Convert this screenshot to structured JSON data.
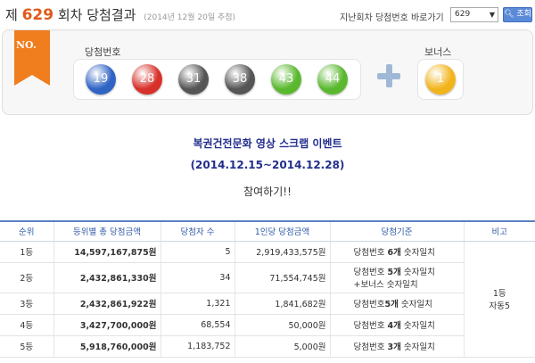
{
  "header": {
    "prefix": "제",
    "round": "629",
    "suffix": "회차 당첨결과",
    "date": "(2014년 12월 20일 추첨)",
    "prev_label": "지난회차 당첨번호 바로가기",
    "select_value": "629",
    "search_label": "조회",
    "search_icon": "magnifier-icon"
  },
  "panel": {
    "ribbon_text": "NO.",
    "winning_label": "당첨번호",
    "bonus_label": "보너스",
    "balls": [
      {
        "number": "19",
        "color": "#2f63c4"
      },
      {
        "number": "28",
        "color": "#d8302a"
      },
      {
        "number": "31",
        "color": "#555555"
      },
      {
        "number": "38",
        "color": "#555555"
      },
      {
        "number": "43",
        "color": "#5ab82e"
      },
      {
        "number": "44",
        "color": "#5ab82e"
      }
    ],
    "bonus": {
      "number": "1",
      "color": "#f2b41c"
    }
  },
  "event": {
    "line1": "복권건전문화 영상 스크랩 이벤트",
    "line2": "(2014.12.15~2014.12.28)",
    "participate": "참여하기!!"
  },
  "table": {
    "headers": [
      "순위",
      "등위별 총 당첨금액",
      "당첨자 수",
      "1인당 당첨금액",
      "당첨기준",
      "비고"
    ],
    "rows": [
      {
        "rank": "1등",
        "total": "14,597,167,875원",
        "winners": "5",
        "per": "2,919,433,575원",
        "crit_pre": "당첨번호 ",
        "crit_bold": "6개",
        "crit_post": " 숫자일치",
        "crit_extra": ""
      },
      {
        "rank": "2등",
        "total": "2,432,861,330원",
        "winners": "34",
        "per": "71,554,745원",
        "crit_pre": "당첨번호 ",
        "crit_bold": "5개",
        "crit_post": " 숫자일치",
        "crit_extra": "+보너스 숫자일치"
      },
      {
        "rank": "3등",
        "total": "2,432,861,922원",
        "winners": "1,321",
        "per": "1,841,682원",
        "crit_pre": "당첨번호",
        "crit_bold": "5개",
        "crit_post": " 숫자일치",
        "crit_extra": ""
      },
      {
        "rank": "4등",
        "total": "3,427,700,000원",
        "winners": "68,554",
        "per": "50,000원",
        "crit_pre": "당첨번호 ",
        "crit_bold": "4개",
        "crit_post": " 숫자일치",
        "crit_extra": ""
      },
      {
        "rank": "5등",
        "total": "5,918,760,000원",
        "winners": "1,183,752",
        "per": "5,000원",
        "crit_pre": "당첨번호 ",
        "crit_bold": "3개",
        "crit_post": " 숫자일치",
        "crit_extra": ""
      }
    ],
    "note_line1": "1등",
    "note_line2": "자동5"
  }
}
